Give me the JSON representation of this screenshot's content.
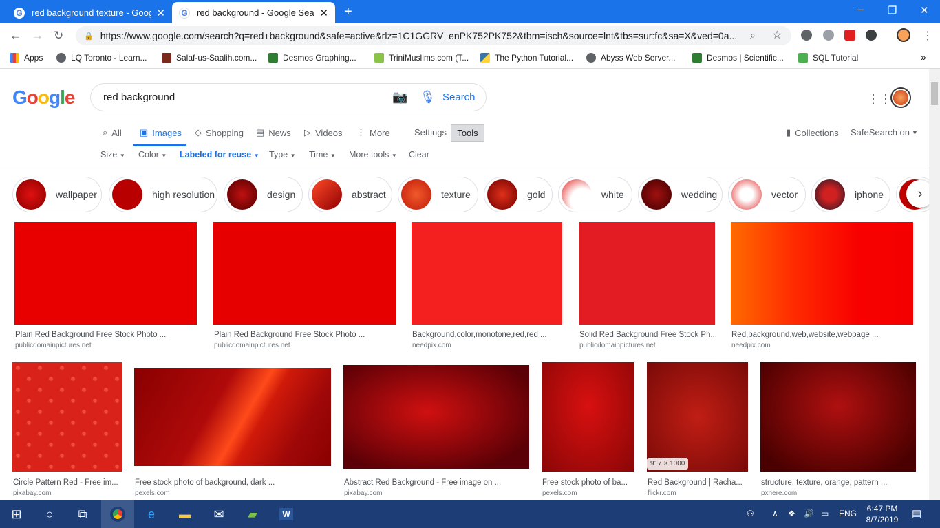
{
  "browser": {
    "tabs": [
      {
        "title": "red background texture - Google",
        "active": false
      },
      {
        "title": "red background - Google Search",
        "active": true
      }
    ],
    "new_tab": "+",
    "url": "https://www.google.com/search?q=red+background&safe=active&rlz=1C1GGRV_enPK752PK752&tbm=isch&source=lnt&tbs=sur:fc&sa=X&ved=0a...",
    "bookmarks": [
      {
        "label": "Apps",
        "icon": "apps-grid-icon"
      },
      {
        "label": "LQ Toronto - Learn...",
        "icon": "globe-icon"
      },
      {
        "label": "Salaf-us-Saalih.com...",
        "icon": "site-icon"
      },
      {
        "label": "Desmos Graphing...",
        "icon": "desmos-icon"
      },
      {
        "label": "TriniMuslims.com (T...",
        "icon": "flag-icon"
      },
      {
        "label": "The Python Tutorial...",
        "icon": "python-icon"
      },
      {
        "label": "Abyss Web Server...",
        "icon": "globe-icon"
      },
      {
        "label": "Desmos | Scientific...",
        "icon": "desmos-icon"
      },
      {
        "label": "SQL Tutorial",
        "icon": "w3-icon"
      }
    ],
    "bookmarks_more": "»"
  },
  "google": {
    "logo": [
      "G",
      "o",
      "o",
      "g",
      "l",
      "e"
    ],
    "logo_colors": [
      "#4285f4",
      "#ea4335",
      "#fbbc05",
      "#4285f4",
      "#34a853",
      "#ea4335"
    ],
    "query": "red background",
    "search_label": "Search",
    "nav_tabs": [
      {
        "label": "All",
        "icon": "search-icon"
      },
      {
        "label": "Images",
        "icon": "image-icon",
        "active": true
      },
      {
        "label": "Shopping",
        "icon": "tag-icon"
      },
      {
        "label": "News",
        "icon": "news-icon"
      },
      {
        "label": "Videos",
        "icon": "play-icon"
      },
      {
        "label": "More",
        "icon": "more-dots-icon"
      }
    ],
    "settings_label": "Settings",
    "tools_label": "Tools",
    "collections_label": "Collections",
    "safesearch_label": "SafeSearch on",
    "filters": [
      "Size",
      "Color",
      "Labeled for reuse",
      "Type",
      "Time",
      "More tools",
      "Clear"
    ],
    "chips": [
      {
        "label": "wallpaper",
        "color": "#c00000"
      },
      {
        "label": "high resolution",
        "color": "#b30000"
      },
      {
        "label": "design",
        "color": "#8b0000"
      },
      {
        "label": "abstract",
        "color": "#cc1a10"
      },
      {
        "label": "texture",
        "color": "#d42a10"
      },
      {
        "label": "gold",
        "color": "#a30a0a"
      },
      {
        "label": "white",
        "color": "#f2d0d0"
      },
      {
        "label": "wedding",
        "color": "#7a0a0a"
      },
      {
        "label": "vector",
        "color": "#e04040"
      },
      {
        "label": "iphone",
        "color": "#2a2a3a"
      }
    ],
    "results": [
      {
        "caption": "Plain Red Background Free Stock Photo ...",
        "source": "publicdomainpictures.net",
        "color": "#e80000"
      },
      {
        "caption": "Plain Red Background Free Stock Photo ...",
        "source": "publicdomainpictures.net",
        "color": "#e60000"
      },
      {
        "caption": "Background,color,monotone,red,red ...",
        "source": "needpix.com",
        "color": "#f42020"
      },
      {
        "caption": "Solid Red Background Free Stock Ph...",
        "source": "publicdomainpictures.net",
        "color": "#e31c23"
      },
      {
        "caption": "Red,background,web,website,webpage ...",
        "source": "needpix.com",
        "color": "#ff3000"
      },
      {
        "caption": "Circle Pattern Red - Free im...",
        "source": "pixabay.com",
        "color": "#e22a20"
      },
      {
        "caption": "Free stock photo of background, dark ...",
        "source": "pexels.com",
        "color": "#b00a0a"
      },
      {
        "caption": "Abstract Red Background - Free image on ...",
        "source": "pixabay.com",
        "color": "#a00008"
      },
      {
        "caption": "Free stock photo of ba...",
        "source": "pexels.com",
        "color": "#c20a0a"
      },
      {
        "caption": "Red Background | Racha...",
        "source": "flickr.com",
        "color": "#a8120e"
      },
      {
        "caption": "structure, texture, orange, pattern ...",
        "source": "pxhere.com",
        "color": "#7a0a0a"
      }
    ],
    "dimension_badge": "917 × 1000"
  },
  "taskbar": {
    "language": "ENG",
    "time": "6:47 PM",
    "date": "8/7/2019"
  }
}
